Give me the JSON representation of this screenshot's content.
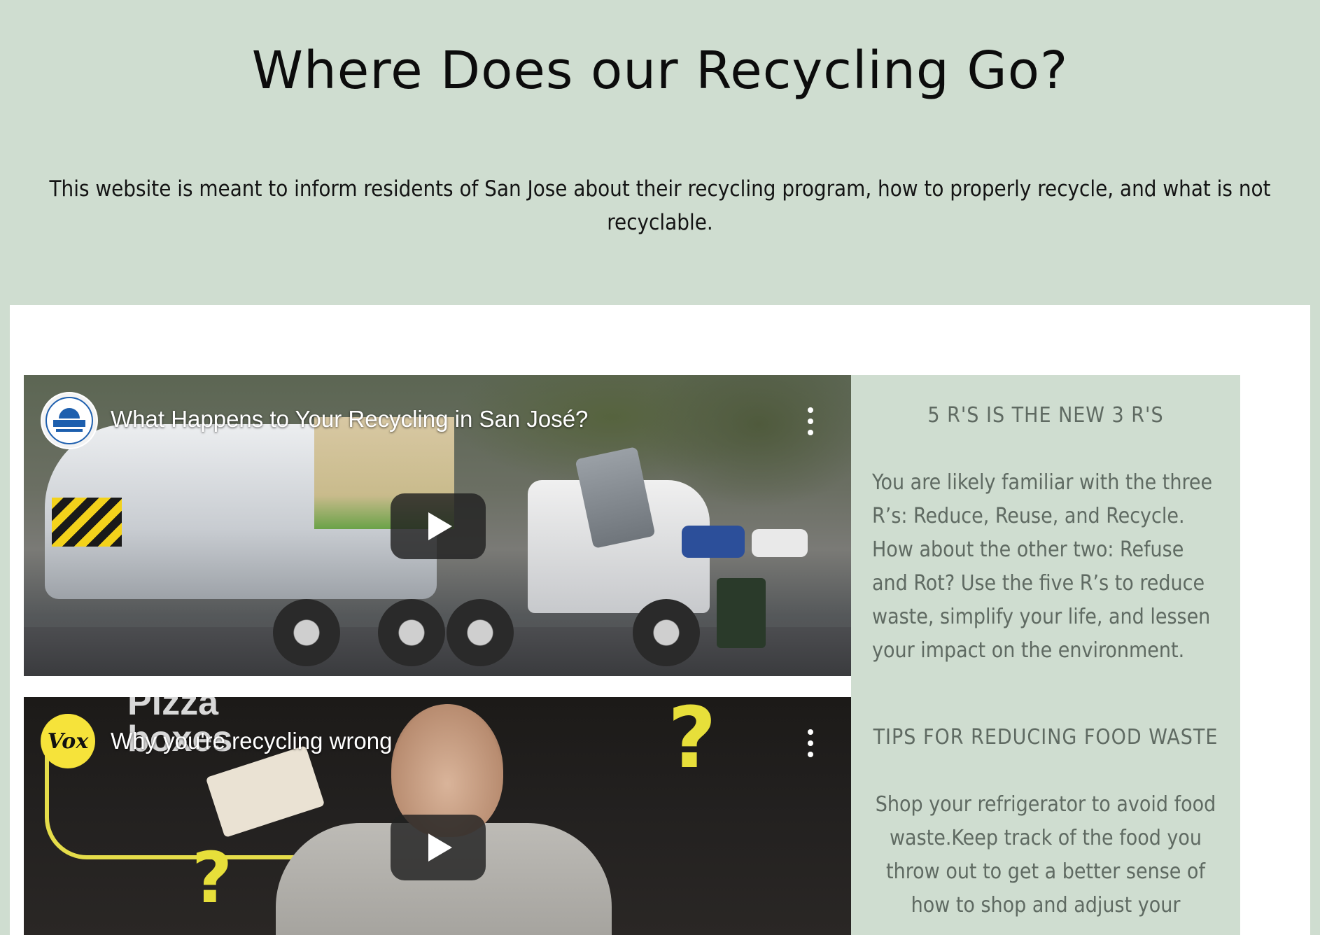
{
  "header": {
    "title": "Where Does our Recycling Go?",
    "subtitle": "This website is meant to inform residents of San Jose about their recycling program, how to properly recycle, and what is not recyclable."
  },
  "videos": [
    {
      "title": "What Happens to Your Recycling in San José?",
      "channel_icon": "san-jose-environment-logo"
    },
    {
      "title": "Why you're recycling wrong",
      "channel_icon": "vox-logo",
      "channel_text": "Vox",
      "overlay_text": "Pizza boxes"
    }
  ],
  "sidebar": {
    "heading_1": "5 R'S IS THE NEW 3 R'S",
    "text_1": "You are likely familiar with the three R’s: Reduce, Reuse, and Recycle. How about the other two: Refuse and Rot? Use the five R’s to reduce waste, simplify your life, and lessen your impact on the environment.",
    "heading_2": "TIPS FOR REDUCING FOOD WASTE",
    "text_2": "Shop your refrigerator to avoid food waste.Keep track of the food you throw out to get a better sense of how to shop and adjust your"
  },
  "colors": {
    "page_background": "#cfddd0",
    "panel_background": "#ffffff",
    "sidebar_text": "#5f6a62",
    "vox_yellow": "#f6e33a"
  }
}
